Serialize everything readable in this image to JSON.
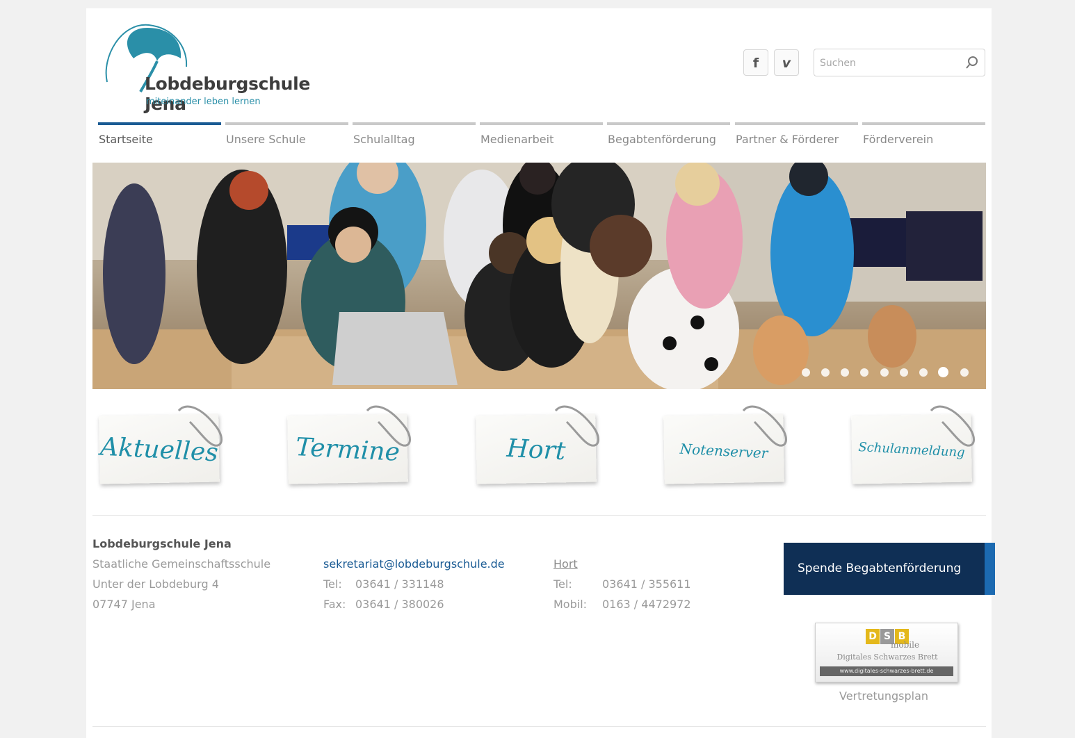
{
  "header": {
    "logo_title": "Lobdeburgschule Jena",
    "logo_subtitle": "miteinander leben lernen",
    "facebook_glyph": "f",
    "vimeo_glyph": "v",
    "search_placeholder": "Suchen"
  },
  "nav": {
    "items": [
      {
        "label": "Startseite",
        "active": true
      },
      {
        "label": "Unsere Schule"
      },
      {
        "label": "Schulalltag"
      },
      {
        "label": "Medienarbeit"
      },
      {
        "label": "Begabtenförderung"
      },
      {
        "label": "Partner & Förderer"
      },
      {
        "label": "Förderverein"
      }
    ]
  },
  "slider": {
    "slide_count": 9,
    "active_index": 7
  },
  "cards": [
    {
      "label": "Aktuelles"
    },
    {
      "label": "Termine"
    },
    {
      "label": "Hort"
    },
    {
      "label": "Notenserver"
    },
    {
      "label": "Schulanmeldung"
    }
  ],
  "footer": {
    "school_name": "Lobdeburgschule Jena",
    "school_type": "Staatliche Gemeinschaftsschule",
    "street": "Unter der Lobdeburg 4",
    "city": "07747 Jena",
    "email": "sekretariat@lobdeburgschule.de",
    "tel_label": "Tel:",
    "tel": "03641 / 331148",
    "fax_label": "Fax:",
    "fax": "03641 / 380026",
    "hort_link": "Hort",
    "hort_tel_label": "Tel:",
    "hort_tel": "03641 / 355611",
    "hort_mobil_label": "Mobil:",
    "hort_mobil": "0163 / 4472972",
    "donate_button": "Spende Begabtenförderung",
    "dsb_letters": [
      "D",
      "S",
      "B"
    ],
    "dsb_mobile": "mobile",
    "dsb_title": "Digitales Schwarzes Brett",
    "dsb_url": "www.digitales-schwarzes-brett.de",
    "vertretungsplan": "Vertretungsplan"
  },
  "colors": {
    "accent_blue": "#1a5b94",
    "teal": "#1f8fa8",
    "donate_bg": "#0f2f55"
  }
}
